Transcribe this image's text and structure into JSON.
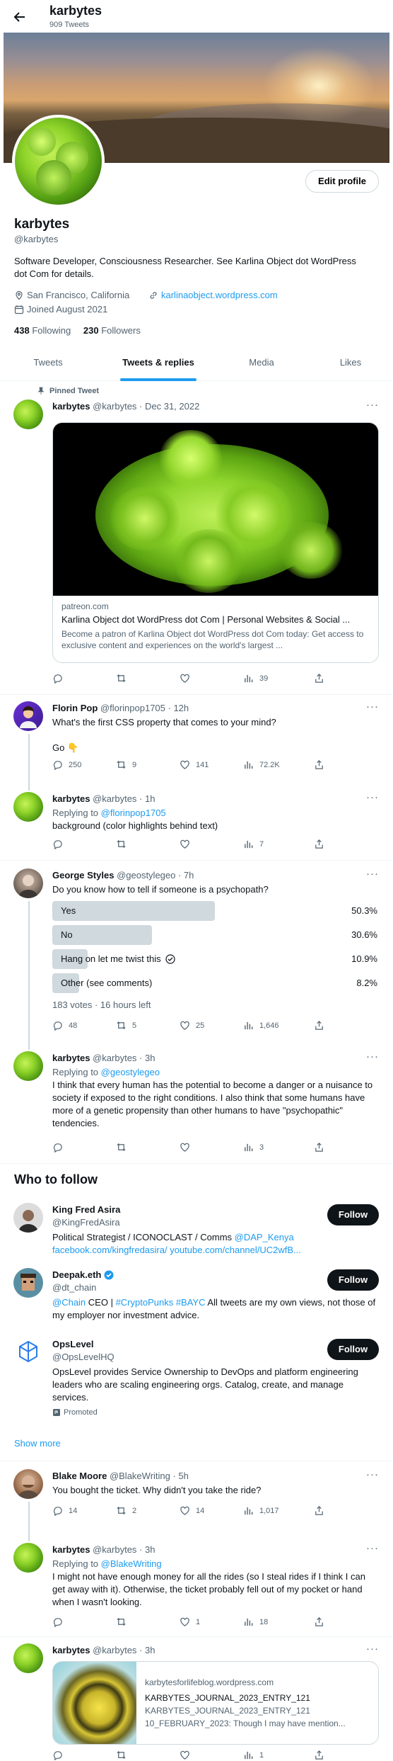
{
  "header": {
    "name": "karbytes",
    "tweet_count": "909 Tweets"
  },
  "profile": {
    "name": "karbytes",
    "handle": "@karbytes",
    "edit_button": "Edit profile",
    "bio": "Software Developer, Consciousness Researcher. See Karlina Object dot WordPress dot Com for details.",
    "location": "San Francisco, California",
    "website": "karlinaobject.wordpress.com",
    "joined": "Joined August 2021",
    "following_count": "438",
    "following_label": "Following",
    "followers_count": "230",
    "followers_label": "Followers"
  },
  "tabs": [
    "Tweets",
    "Tweets & replies",
    "Media",
    "Likes"
  ],
  "active_tab": "Tweets & replies",
  "tweets": [
    {
      "pinned_label": "Pinned Tweet",
      "name": "karbytes",
      "meta": "@karbytes · Dec 31, 2022",
      "card": {
        "domain": "patreon.com",
        "title": "Karlina Object dot WordPress dot Com | Personal Websites & Social ...",
        "desc": "Become a patron of Karlina Object dot WordPress dot Com today: Get access to exclusive content and experiences on the world's largest ..."
      },
      "stats": {
        "replies": "",
        "retweets": "",
        "likes": "",
        "views": "39"
      }
    },
    {
      "name": "Florin Pop",
      "meta": "@florinpop1705 · 12h",
      "text": "What's the first CSS property that comes to your mind?",
      "text2": "Go 👇",
      "stats": {
        "replies": "250",
        "retweets": "9",
        "likes": "141",
        "views": "72.2K"
      }
    },
    {
      "name": "karbytes",
      "meta": "@karbytes · 1h",
      "replying_prefix": "Replying to",
      "replying_to": "@florinpop1705",
      "text": "background (color highlights behind text)",
      "stats": {
        "replies": "",
        "retweets": "",
        "likes": "",
        "views": "7"
      }
    },
    {
      "name": "George Styles",
      "meta": "@geostylegeo · 7h",
      "text": "Do you know how to tell if someone is a psychopath?",
      "poll": [
        {
          "label": "Yes",
          "pct": "50.3%",
          "value": 50.3
        },
        {
          "label": "No",
          "pct": "30.6%",
          "value": 30.6
        },
        {
          "label": "Hang on let me twist this",
          "pct": "10.9%",
          "value": 10.9
        },
        {
          "label": "Other (see comments)",
          "pct": "8.2%",
          "value": 8.2
        }
      ],
      "poll_footer": "183 votes · 16 hours left",
      "stats": {
        "replies": "48",
        "retweets": "5",
        "likes": "25",
        "views": "1,646"
      }
    },
    {
      "name": "karbytes",
      "meta": "@karbytes · 3h",
      "replying_prefix": "Replying to",
      "replying_to": "@geostylegeo",
      "text": "I think that every human has the potential to become a danger or a nuisance to society if exposed to the right conditions. I also think that some humans have more of a genetic propensity than other humans to have \"psychopathic\" tendencies.",
      "stats": {
        "replies": "",
        "retweets": "",
        "likes": "",
        "views": "3"
      }
    }
  ],
  "who_to_follow": {
    "title": "Who to follow",
    "follow_label": "Follow",
    "accounts": [
      {
        "name": "King Fred Asira",
        "handle": "@KingFredAsira",
        "bio_text": "Political Strategist / ICONOCLAST / Comms ",
        "bio_link": "@DAP_Kenya facebook.com/kingfredasira/ youtube.com/channel/UC2wfB..."
      },
      {
        "name": "Deepak.eth",
        "handle": "@dt_chain",
        "bio_link": "@Chain",
        "bio_text": " CEO | ",
        "bio_link2": "#CryptoPunks #BAYC",
        "bio_text2": " All tweets are my own views, not those of my employer nor investment advice."
      },
      {
        "name": "OpsLevel",
        "handle": "@OpsLevelHQ",
        "bio_text": "OpsLevel provides Service Ownership to DevOps and platform engineering leaders who are scaling engineering orgs. Catalog, create, and manage services.",
        "promoted": "Promoted"
      }
    ],
    "show_more": "Show more"
  },
  "tweets2": [
    {
      "name": "Blake Moore",
      "meta": "@BlakeWriting · 5h",
      "text": "You bought the ticket. Why didn't you take the ride?",
      "stats": {
        "replies": "14",
        "retweets": "2",
        "likes": "14",
        "views": "1,017"
      }
    },
    {
      "name": "karbytes",
      "meta": "@karbytes · 3h",
      "replying_prefix": "Replying to",
      "replying_to": "@BlakeWriting",
      "text": "I might not have enough money for all the rides (so I steal rides if I think I can get away with it). Otherwise, the ticket probably fell out of my pocket or hand when I wasn't looking.",
      "stats": {
        "replies": "",
        "retweets": "",
        "likes": "1",
        "views": "18"
      }
    },
    {
      "name": "karbytes",
      "meta": "@karbytes · 3h",
      "card": {
        "domain": "karbytesforlifeblog.wordpress.com",
        "title": "KARBYTES_JOURNAL_2023_ENTRY_121",
        "subtitle": "KARBYTES_JOURNAL_2023_ENTRY_121",
        "desc": "10_FEBRUARY_2023: Though I may have mention..."
      },
      "stats": {
        "replies": "",
        "retweets": "",
        "likes": "",
        "views": "1"
      }
    }
  ]
}
